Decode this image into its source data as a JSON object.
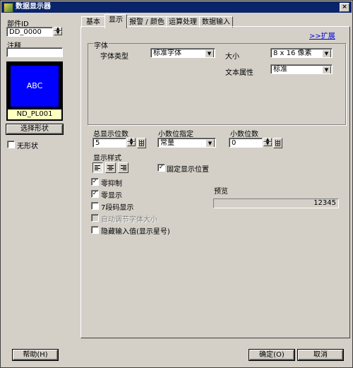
{
  "window": {
    "title": "数据显示器"
  },
  "left": {
    "part_id_label": "部件ID",
    "part_id_value": "DD_0000",
    "comment_label": "注释",
    "comment_value": "",
    "preview_text": "ABC",
    "preview_name": "ND_PL001",
    "select_shape_label": "选择形状",
    "no_shape_label": "无形状",
    "no_shape_checked": false
  },
  "tabs": [
    {
      "label": "基本",
      "active": false
    },
    {
      "label": "显示",
      "active": true
    },
    {
      "label": "报警 / 颜色",
      "active": false
    },
    {
      "label": "运算处理",
      "active": false
    },
    {
      "label": "数据输入",
      "active": false
    }
  ],
  "display": {
    "expand_link": ">>扩展",
    "font_group_title": "字体",
    "font_type_label": "字体类型",
    "font_type_value": "标准字体",
    "size_label": "大小",
    "size_value": "8 x 16  像素",
    "text_attr_label": "文本属性",
    "text_attr_value": "标准",
    "total_digits_label": "总显示位数",
    "total_digits_value": "5",
    "decimal_spec_label": "小数位指定",
    "decimal_spec_value": "常量",
    "decimal_digits_label": "小数位数",
    "decimal_digits_value": "0",
    "display_style_label": "显示样式",
    "alignment_selected": "left",
    "fixed_position_label": "固定显示位置",
    "fixed_position_checked": true,
    "zero_suppress_label": "零抑制",
    "zero_suppress_checked": true,
    "zero_display_label": "零显示",
    "zero_display_checked": true,
    "seven_seg_label": "7段码显示",
    "seven_seg_checked": false,
    "auto_font_label": "自动调节字体大小",
    "auto_font_checked": false,
    "hide_input_label": "隐藏输入值(显示星号)",
    "hide_input_checked": false,
    "preview_label": "预览",
    "preview_value": "12345"
  },
  "footer": {
    "help_label": "帮助(H)",
    "ok_label": "确定(O)",
    "cancel_label": "取消"
  },
  "colors": {
    "titlebar": "#0a246a",
    "preview_bg": "#0000ff",
    "preview_name_bg": "#ffffc0",
    "link": "#0000cc"
  }
}
